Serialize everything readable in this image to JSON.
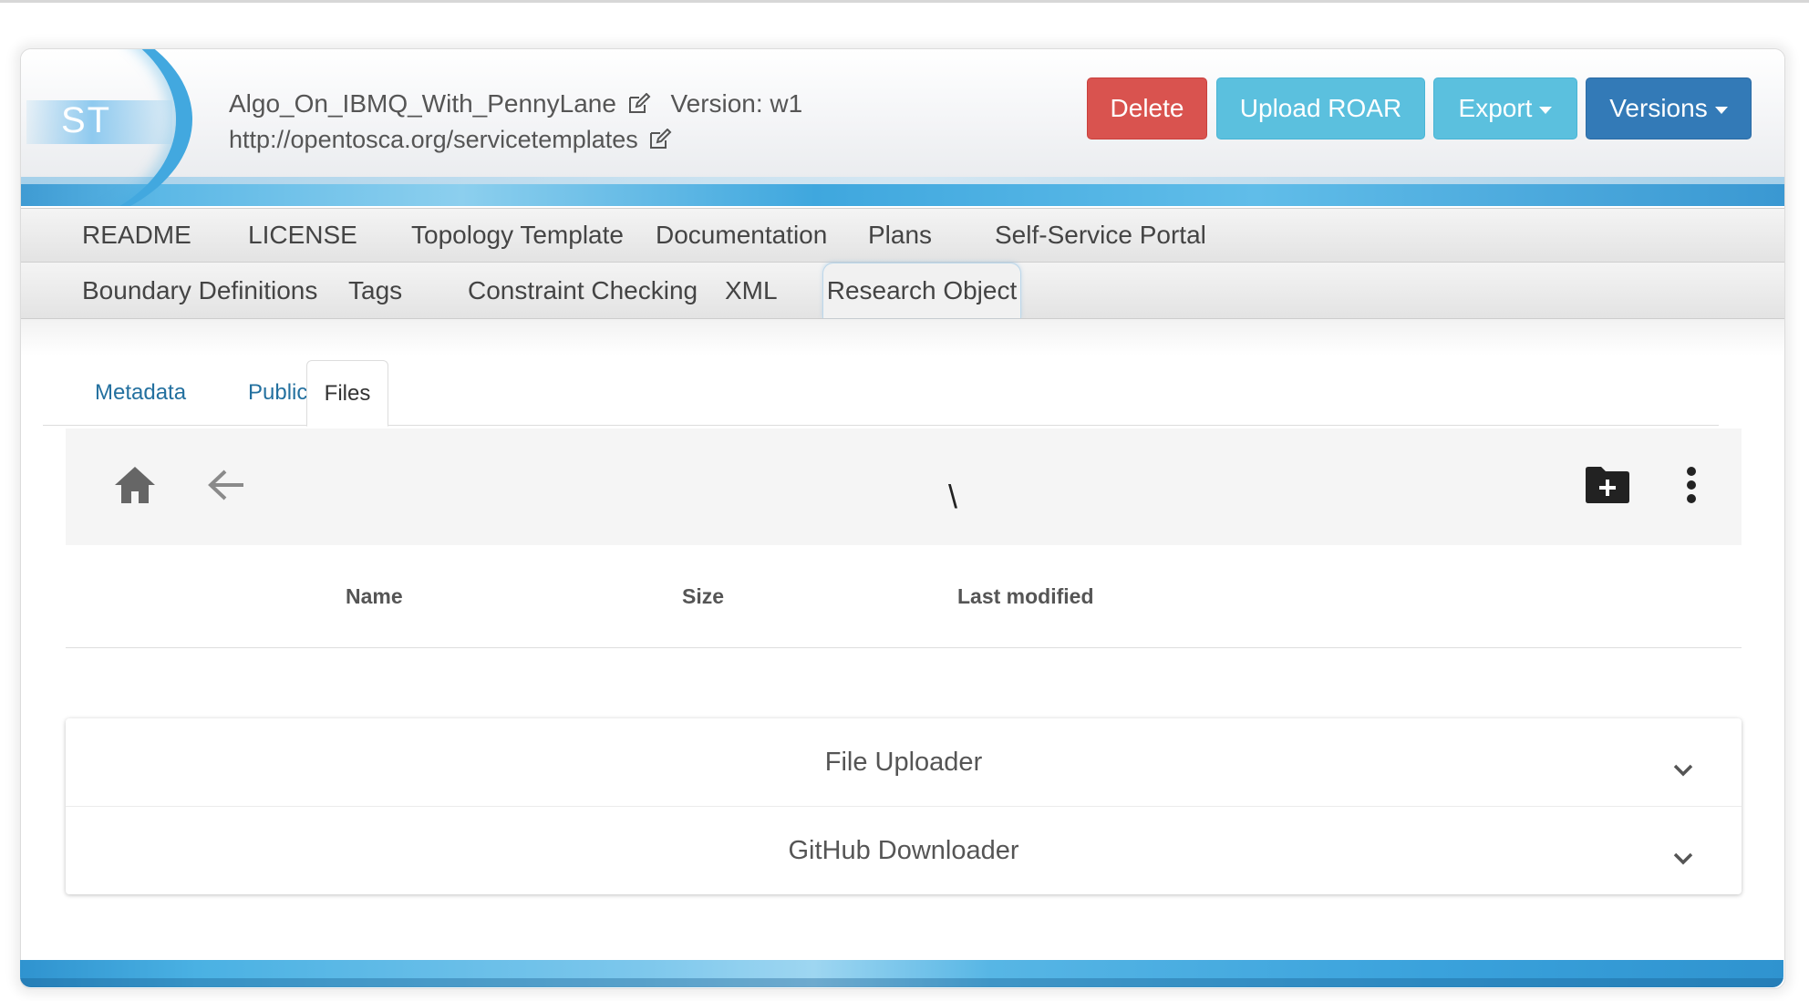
{
  "header": {
    "logo_text": "ST",
    "name": "Algo_On_IBMQ_With_PennyLane",
    "version_label": "Version: w1",
    "namespace": "http://opentosca.org/servicetemplates",
    "buttons": {
      "delete": "Delete",
      "upload": "Upload ROAR",
      "export": "Export",
      "versions": "Versions"
    },
    "colors": {
      "delete": "#d9534f",
      "info": "#5bc0de",
      "primary": "#337ab7"
    }
  },
  "nav": {
    "row1": [
      "README",
      "LICENSE",
      "Topology Template",
      "Documentation",
      "Plans",
      "Self-Service Portal"
    ],
    "row2": [
      "Boundary Definitions",
      "Tags",
      "Constraint Checking",
      "XML",
      "Research Object"
    ],
    "active": "Research Object"
  },
  "research_object": {
    "tabs": [
      "Metadata",
      "Publication",
      "Files"
    ],
    "active_tab": "Files",
    "file_browser": {
      "current_path": "\\",
      "icons": [
        "home-icon",
        "arrow-back-icon",
        "new-folder-icon",
        "more-vert-icon"
      ],
      "columns": [
        "Name",
        "Size",
        "Last modified"
      ]
    },
    "panels": [
      "File Uploader",
      "GitHub Downloader"
    ]
  }
}
